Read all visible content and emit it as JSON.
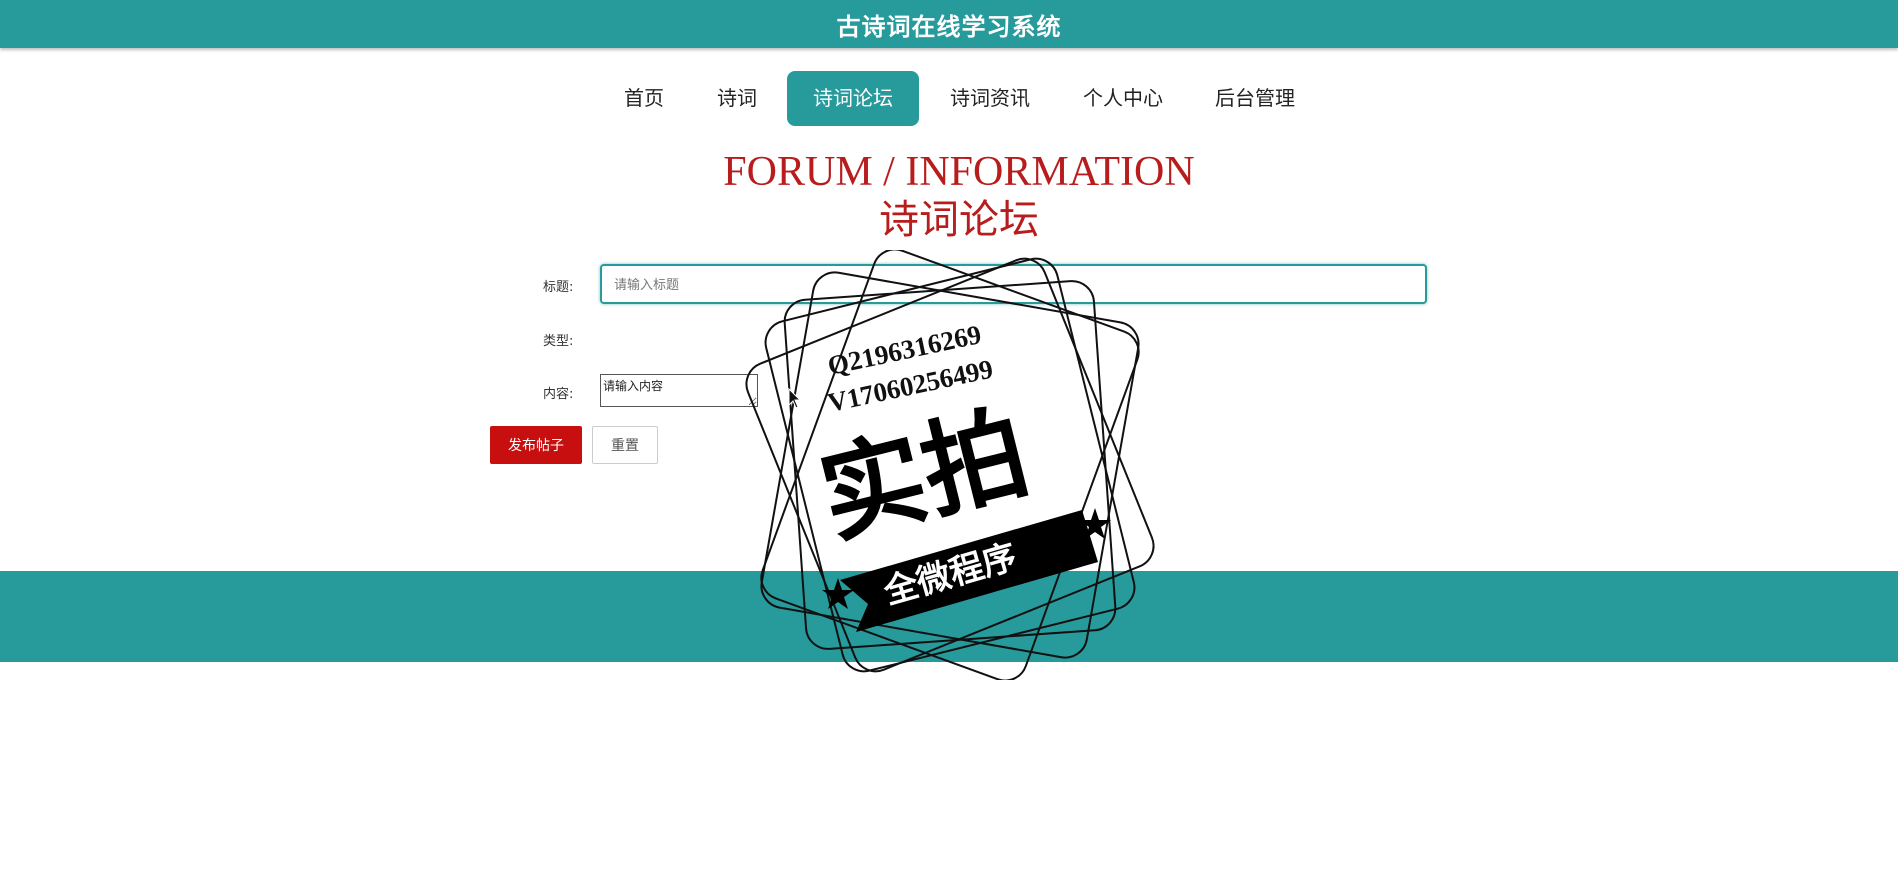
{
  "header": {
    "app_title": "古诗词在线学习系统"
  },
  "nav": {
    "items": [
      {
        "label": "首页",
        "active": false
      },
      {
        "label": "诗词",
        "active": false
      },
      {
        "label": "诗词论坛",
        "active": true
      },
      {
        "label": "诗词资讯",
        "active": false
      },
      {
        "label": "个人中心",
        "active": false
      },
      {
        "label": "后台管理",
        "active": false
      }
    ]
  },
  "page": {
    "heading_en": "FORUM / INFORMATION",
    "heading_cn": "诗词论坛"
  },
  "form": {
    "title_label": "标题:",
    "title_placeholder": "请输入标题",
    "type_label": "类型:",
    "content_label": "内容:",
    "content_placeholder": "请输入内容",
    "publish_label": "发布帖子",
    "reset_label": "重置"
  },
  "watermark": {
    "line1": "Q2196316269",
    "line2": "V17060256499",
    "big_text": "实拍",
    "ribbon_text": "全微程序"
  },
  "colors": {
    "primary": "#279a9c",
    "accent_red": "#c80f0f",
    "heading_red": "#b81c1c"
  }
}
